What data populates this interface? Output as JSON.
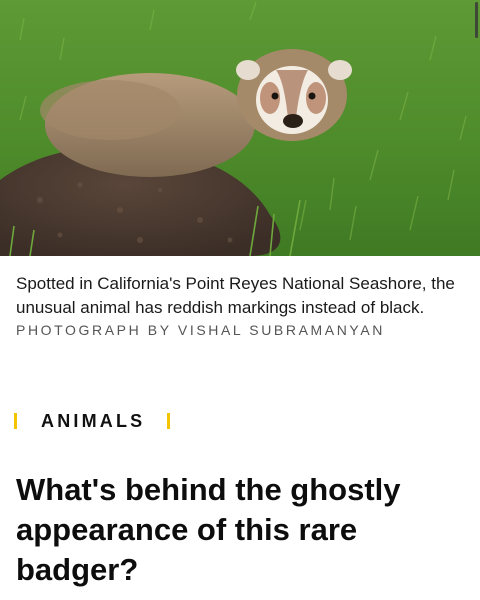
{
  "photo": {
    "subject": "badger-photo",
    "colors": {
      "grass": "#4f8a2e",
      "dirt": "#4a3a30",
      "fur": "#a58a6a"
    }
  },
  "caption": "Spotted in California's Point Reyes National Seashore, the unusual animal has reddish markings instead of black.",
  "credit": "PHOTOGRAPH BY VISHAL SUBRAMANYAN",
  "section": {
    "label": "ANIMALS",
    "accent_color": "#f5c400"
  },
  "headline": "What's behind the ghostly appearance of this rare badger?"
}
